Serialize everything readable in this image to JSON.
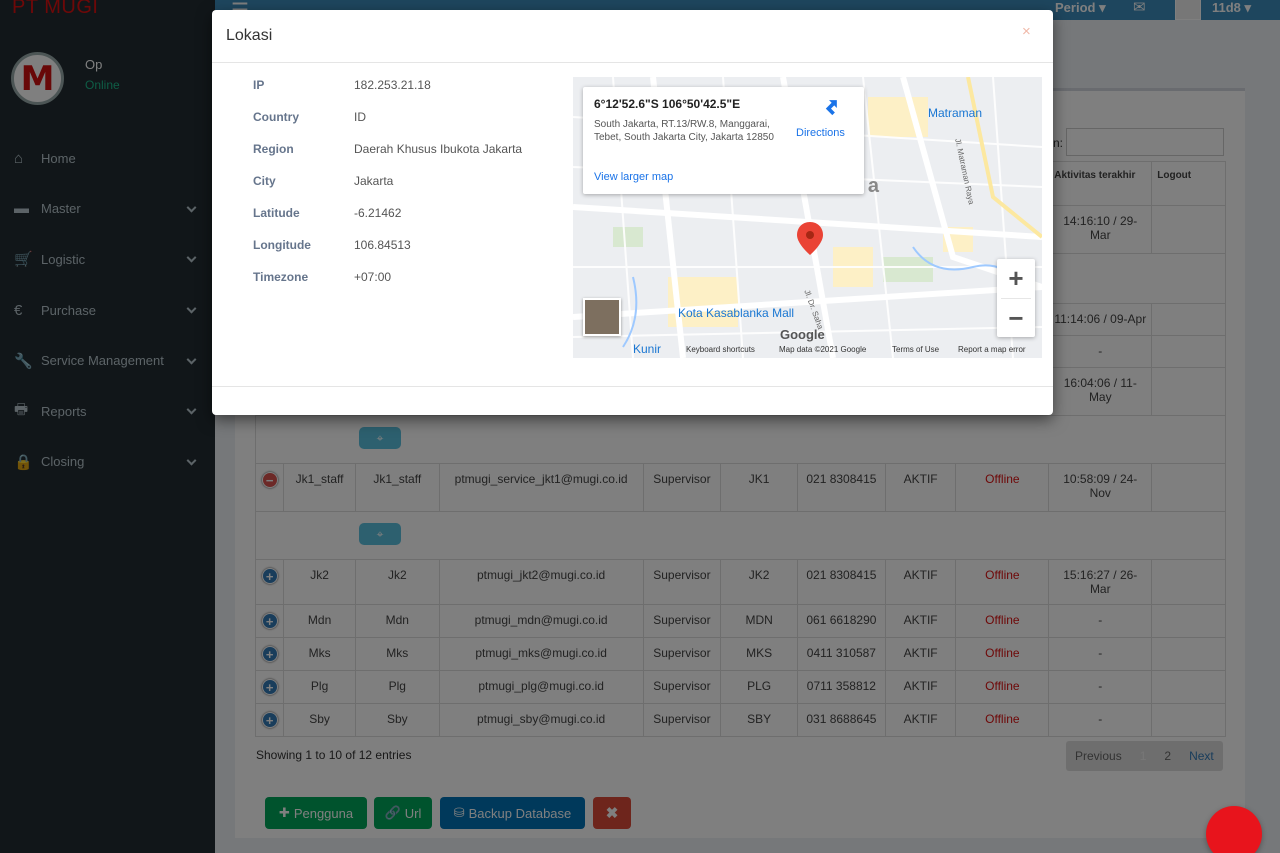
{
  "app": {
    "brand": "PT MUGI"
  },
  "sidebar": {
    "user": {
      "name": "Op",
      "status": "Online"
    },
    "items": [
      {
        "label": "Home",
        "icon": "home-icon",
        "glyph": "⌂",
        "has_sub": false
      },
      {
        "label": "Master",
        "icon": "hdd-icon",
        "glyph": "▬",
        "has_sub": true
      },
      {
        "label": "Logistic",
        "icon": "cart-icon",
        "glyph": "🛒",
        "has_sub": true
      },
      {
        "label": "Purchase",
        "icon": "euro-icon",
        "glyph": "€",
        "has_sub": true
      },
      {
        "label": "Service Management",
        "icon": "wrench-icon",
        "glyph": "🔧",
        "has_sub": true
      },
      {
        "label": "Reports",
        "icon": "print-icon",
        "glyph": "🖶",
        "has_sub": true
      },
      {
        "label": "Closing",
        "icon": "lock-icon",
        "glyph": "🔒",
        "has_sub": true
      }
    ]
  },
  "topbar": {
    "period": "Period",
    "user": "11d8"
  },
  "table": {
    "search_label": "n:",
    "headers": [
      "",
      "",
      "",
      "",
      "",
      "",
      "",
      "",
      "",
      "Aktivitas terakhir",
      "Logout"
    ],
    "rows": [
      {
        "expand": "minus",
        "user": "Jk1_staff",
        "name": "Jk1_staff",
        "email": "ptmugi_service_jkt1@mugi.co.id",
        "role": "Supervisor",
        "branch": "JK1",
        "phone": "021 8308415",
        "status": "AKTIF",
        "online": "Offline",
        "activity": "10:58:09 / 24-Nov",
        "logout": ""
      },
      {
        "expand": "plus",
        "user": "Jk2",
        "name": "Jk2",
        "email": "ptmugi_jkt2@mugi.co.id",
        "role": "Supervisor",
        "branch": "JK2",
        "phone": "021 8308415",
        "status": "AKTIF",
        "online": "Offline",
        "activity": "15:16:27 / 26-Mar",
        "logout": ""
      },
      {
        "expand": "plus",
        "user": "Mdn",
        "name": "Mdn",
        "email": "ptmugi_mdn@mugi.co.id",
        "role": "Supervisor",
        "branch": "MDN",
        "phone": "061 6618290",
        "status": "AKTIF",
        "online": "Offline",
        "activity": "-",
        "logout": ""
      },
      {
        "expand": "plus",
        "user": "Mks",
        "name": "Mks",
        "email": "ptmugi_mks@mugi.co.id",
        "role": "Supervisor",
        "branch": "MKS",
        "phone": "0411 310587",
        "status": "AKTIF",
        "online": "Offline",
        "activity": "-",
        "logout": ""
      },
      {
        "expand": "plus",
        "user": "Plg",
        "name": "Plg",
        "email": "ptmugi_plg@mugi.co.id",
        "role": "Supervisor",
        "branch": "PLG",
        "phone": "0711 358812",
        "status": "AKTIF",
        "online": "Offline",
        "activity": "-",
        "logout": ""
      },
      {
        "expand": "plus",
        "user": "Sby",
        "name": "Sby",
        "email": "ptmugi_sby@mugi.co.id",
        "role": "Supervisor",
        "branch": "SBY",
        "phone": "031 8688645",
        "status": "AKTIF",
        "online": "Offline",
        "activity": "-",
        "logout": ""
      }
    ],
    "partial_activity": [
      "14:16:10 / 29-Mar",
      "11:14:06 / 09-Apr",
      "-",
      "16:04:06 / 11-May"
    ],
    "info": "Showing 1 to 10 of 12 entries",
    "pager": {
      "prev": "Previous",
      "pages": [
        "1",
        "2"
      ],
      "next": "Next"
    }
  },
  "actions": {
    "add_user": "Pengguna",
    "url": "Url",
    "backup": "Backup Database",
    "close": "✖"
  },
  "modal": {
    "title": "Lokasi",
    "close": "×",
    "fields": [
      {
        "key": "IP",
        "value": "182.253.21.18"
      },
      {
        "key": "Country",
        "value": "ID"
      },
      {
        "key": "Region",
        "value": "Daerah Khusus Ibukota Jakarta"
      },
      {
        "key": "City",
        "value": "Jakarta"
      },
      {
        "key": "Latitude",
        "value": "-6.21462"
      },
      {
        "key": "Longitude",
        "value": "106.84513"
      },
      {
        "key": "Timezone",
        "value": "+07:00"
      }
    ],
    "map": {
      "coords": "6°12'52.6\"S 106°50'42.5\"E",
      "address": "South Jakarta, RT.13/RW.8, Manggarai, Tebet, South Jakarta City, Jakarta 12850",
      "larger_link": "View larger map",
      "directions": "Directions",
      "city_label": "Jakarta",
      "pois": [
        "Matraman",
        "Kota Kasablanka Mall",
        "Kunir"
      ],
      "streets": [
        "Jl. Matraman Raya",
        "Jl. Dr. Saha"
      ],
      "footer": {
        "shortcuts": "Keyboard shortcuts",
        "data": "Map data ©2021 Google",
        "terms": "Terms of Use",
        "report": "Report a map error"
      },
      "zoom_in": "+",
      "zoom_out": "−",
      "google": "Google"
    }
  },
  "colors": {
    "sidebar": "#222d32",
    "topbar": "#3c8dbc",
    "offline": "#dd1111",
    "online": "#1cbb8c"
  }
}
